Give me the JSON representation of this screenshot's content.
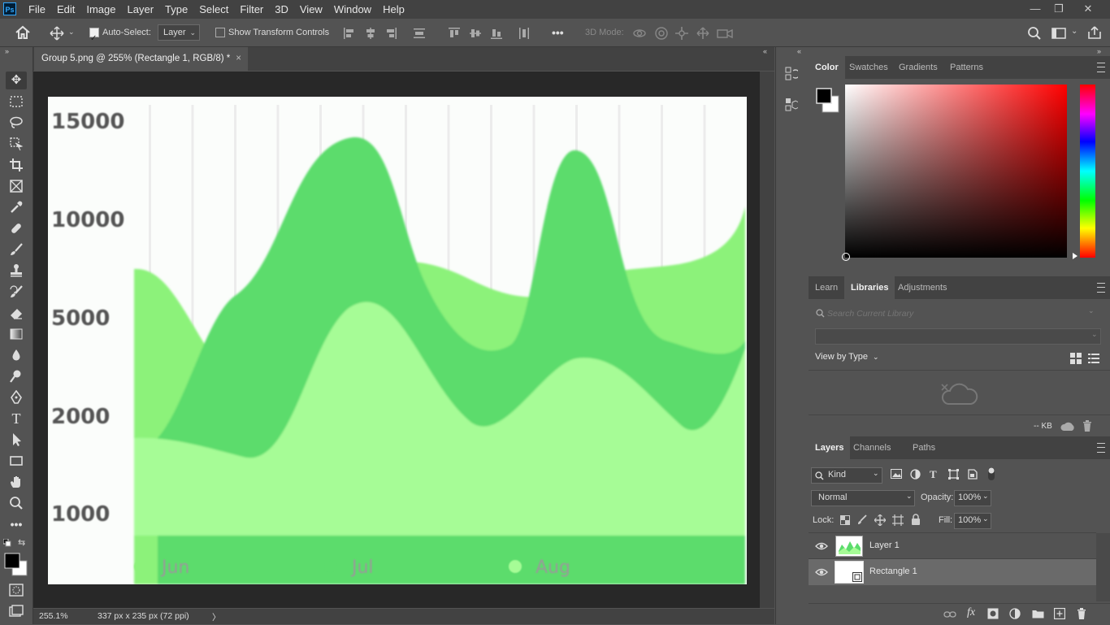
{
  "app": {
    "logo": "Ps"
  },
  "menubar": {
    "items": [
      "File",
      "Edit",
      "Image",
      "Layer",
      "Type",
      "Select",
      "Filter",
      "3D",
      "View",
      "Window",
      "Help"
    ]
  },
  "window_controls": {
    "minimize": "—",
    "restore": "❐",
    "close": "✕"
  },
  "options_bar": {
    "auto_select_label": "Auto-Select:",
    "auto_select_checked": true,
    "layer_select_value": "Layer",
    "show_transform_label": "Show Transform Controls",
    "show_transform_checked": false,
    "more_label": "•••",
    "mode_3d_label": "3D Mode:"
  },
  "document_tab": {
    "title": "Group 5.png @ 255% (Rectangle 1, RGB/8) *",
    "close": "×"
  },
  "status_bar": {
    "zoom": "255.1%",
    "doc_info": "337 px x 235 px (72 ppi)",
    "arrow": "〉"
  },
  "chart_data": {
    "type": "area",
    "categories": [
      "Jun",
      "Jul",
      "Aug"
    ],
    "y_tick_labels": [
      "15000",
      "10000",
      "5000",
      "2000",
      "1000"
    ],
    "series": [
      {
        "name": "Jun",
        "color": "#8cf27a"
      },
      {
        "name": "Jul",
        "color": "#5cdc6c"
      },
      {
        "name": "Aug",
        "color": "#a6fc96"
      }
    ],
    "grid": "vertical"
  },
  "color_panel": {
    "tabs": [
      "Color",
      "Swatches",
      "Gradients",
      "Patterns"
    ],
    "active_tab": "Color",
    "foreground": "#000000",
    "background": "#ffffff",
    "hue": "#ff0000"
  },
  "libraries_panel": {
    "tabs": [
      "Learn",
      "Libraries",
      "Adjustments"
    ],
    "active_tab": "Libraries",
    "search_placeholder": "Search Current Library",
    "view_by_label": "View by Type",
    "size_label": "-- KB"
  },
  "layers_panel": {
    "tabs": [
      "Layers",
      "Channels",
      "Paths"
    ],
    "active_tab": "Layers",
    "filter_kind": "Kind",
    "blend_mode": "Normal",
    "opacity_label": "Opacity:",
    "opacity_value": "100%",
    "lock_label": "Lock:",
    "fill_label": "Fill:",
    "fill_value": "100%",
    "layers": [
      {
        "name": "Layer 1",
        "selected": false
      },
      {
        "name": "Rectangle 1",
        "selected": true
      }
    ]
  }
}
